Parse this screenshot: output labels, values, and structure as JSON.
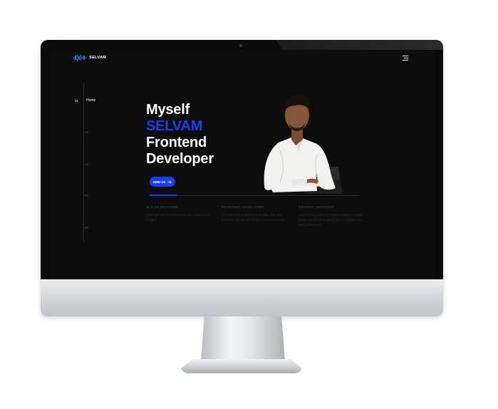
{
  "logo": {
    "text": "SELVAM",
    "icon": "sound-wave-icon",
    "color": "#2f7cf6"
  },
  "header": {
    "menu_icon": "hamburger-menu-icon"
  },
  "nav": {
    "items": [
      {
        "num": "01",
        "label": "Home"
      },
      {
        "num": "02"
      },
      {
        "num": "03"
      },
      {
        "num": "04"
      },
      {
        "num": "05"
      }
    ]
  },
  "hero": {
    "line1": "Myself",
    "line2": "SELVAM",
    "line3": "Frontend",
    "line4": "Developer",
    "button_label": "HIRE US",
    "button_icon": "arrow-right-icon",
    "accent": "#1e3cf0"
  },
  "cards": [
    {
      "title": "UI & UX DESIGNER",
      "text": "I am expertise for ui and ux design. I used a tool of figma"
    },
    {
      "title": "FRONTEND DEVELOPER",
      "text": "I'll create a lively website or landing page and portfolios with the use of html css and javascript"
    },
    {
      "title": "GRAPHIC DESIGNER",
      "text": "I worked four years of Graphic Designer in social media management agency and completed shot also a freelancer"
    }
  ]
}
